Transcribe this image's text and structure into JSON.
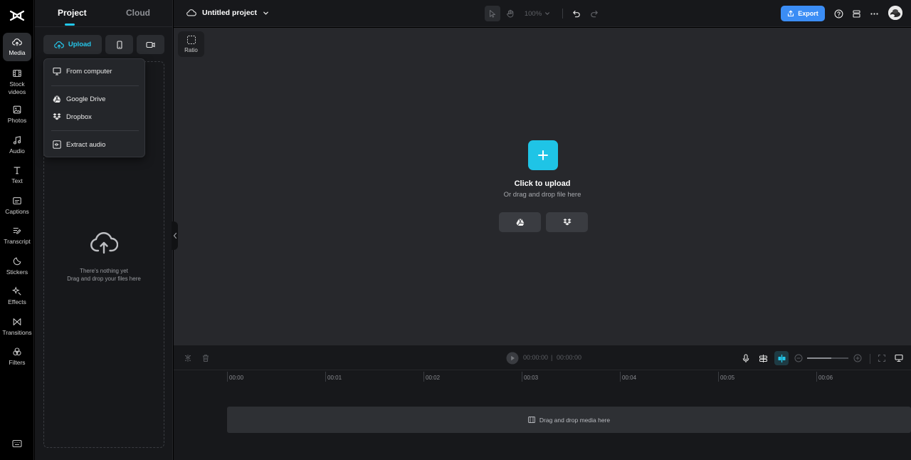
{
  "rail": {
    "items": [
      {
        "id": "media",
        "label": "Media",
        "icon": "cloud-upload-icon"
      },
      {
        "id": "stock-videos",
        "label": "Stock\nvideos",
        "icon": "film-icon"
      },
      {
        "id": "photos",
        "label": "Photos",
        "icon": "image-icon"
      },
      {
        "id": "audio",
        "label": "Audio",
        "icon": "music-note-icon"
      },
      {
        "id": "text",
        "label": "Text",
        "icon": "text-icon"
      },
      {
        "id": "captions",
        "label": "Captions",
        "icon": "captions-icon"
      },
      {
        "id": "transcript",
        "label": "Transcript",
        "icon": "transcript-icon"
      },
      {
        "id": "stickers",
        "label": "Stickers",
        "icon": "sticker-icon"
      },
      {
        "id": "effects",
        "label": "Effects",
        "icon": "sparkle-icon"
      },
      {
        "id": "transitions",
        "label": "Transitions",
        "icon": "transition-icon"
      },
      {
        "id": "filters",
        "label": "Filters",
        "icon": "filter-icon"
      }
    ]
  },
  "panel": {
    "tabs": {
      "project": "Project",
      "cloud": "Cloud"
    },
    "upload_label": "Upload",
    "empty_line1": "There's nothing yet",
    "empty_line2": "Drag and drop your files here"
  },
  "upload_menu": {
    "from_computer": "From computer",
    "google_drive": "Google Drive",
    "dropbox": "Dropbox",
    "extract_audio": "Extract audio"
  },
  "topbar": {
    "project_title": "Untitled project",
    "zoom": "100%",
    "export_label": "Export"
  },
  "canvas": {
    "ratio_label": "Ratio",
    "upload_title": "Click to upload",
    "upload_subtitle": "Or drag and drop file here"
  },
  "timeline": {
    "current_time": "00:00:00",
    "separator": "|",
    "total_time": "00:00:00",
    "ruler": [
      "00:00",
      "00:01",
      "00:02",
      "00:03",
      "00:04",
      "00:05",
      "00:06"
    ],
    "drop_hint": "Drag and drop media here"
  },
  "colors": {
    "accent": "#22c7ea",
    "export": "#3b8df5",
    "background": "#17181b",
    "canvas": "#27282c"
  }
}
